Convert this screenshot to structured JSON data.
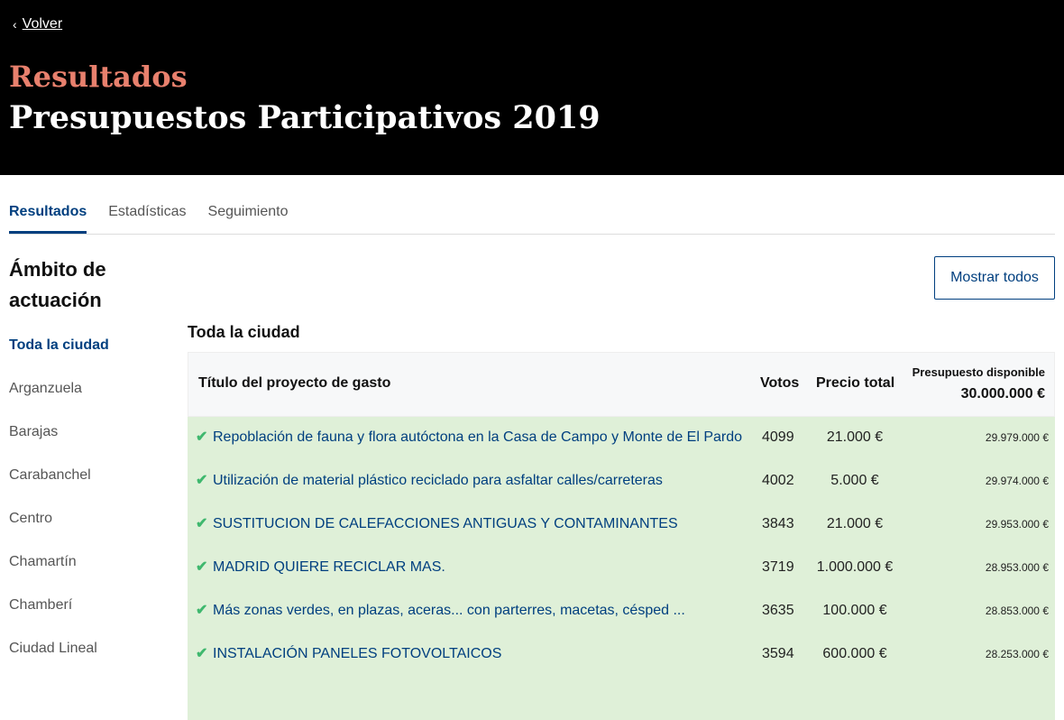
{
  "header": {
    "back_label": "Volver",
    "subtitle": "Resultados",
    "title": "Presupuestos Participativos 2019"
  },
  "tabs": [
    {
      "label": "Resultados",
      "active": true
    },
    {
      "label": "Estadísticas",
      "active": false
    },
    {
      "label": "Seguimiento",
      "active": false
    }
  ],
  "sidebar": {
    "heading_line1": "Ámbito de",
    "heading_line2": "actuación",
    "districts": [
      {
        "label": "Toda la ciudad",
        "active": true
      },
      {
        "label": "Arganzuela"
      },
      {
        "label": "Barajas"
      },
      {
        "label": "Carabanchel"
      },
      {
        "label": "Centro"
      },
      {
        "label": "Chamartín"
      },
      {
        "label": "Chamberí"
      },
      {
        "label": "Ciudad Lineal"
      }
    ]
  },
  "show_all_label": "Mostrar todos",
  "section_title": "Toda la ciudad",
  "table": {
    "col_title": "Título del proyecto de gasto",
    "col_votes": "Votos",
    "col_price": "Precio total",
    "col_budget_label": "Presupuesto disponible",
    "col_budget_value": "30.000.000 €",
    "check_icon": "✔",
    "rows": [
      {
        "title": "Repoblación de fauna y flora autóctona en la Casa de Campo y Monte de El Pardo",
        "votes": "4099",
        "price": "21.000 €",
        "remaining": "29.979.000 €"
      },
      {
        "title": "Utilización de material plástico reciclado para asfaltar calles/carreteras",
        "votes": "4002",
        "price": "5.000 €",
        "remaining": "29.974.000 €"
      },
      {
        "title": "SUSTITUCION DE CALEFACCIONES ANTIGUAS Y CONTAMINANTES",
        "votes": "3843",
        "price": "21.000 €",
        "remaining": "29.953.000 €"
      },
      {
        "title": "MADRID QUIERE RECICLAR MAS.",
        "votes": "3719",
        "price": "1.000.000 €",
        "remaining": "28.953.000 €"
      },
      {
        "title": "Más zonas verdes, en plazas, aceras... con parterres, macetas, césped ...",
        "votes": "3635",
        "price": "100.000 €",
        "remaining": "28.853.000 €"
      },
      {
        "title": "INSTALACIÓN PANELES FOTOVOLTAICOS",
        "votes": "3594",
        "price": "600.000 €",
        "remaining": "28.253.000 €"
      }
    ]
  }
}
